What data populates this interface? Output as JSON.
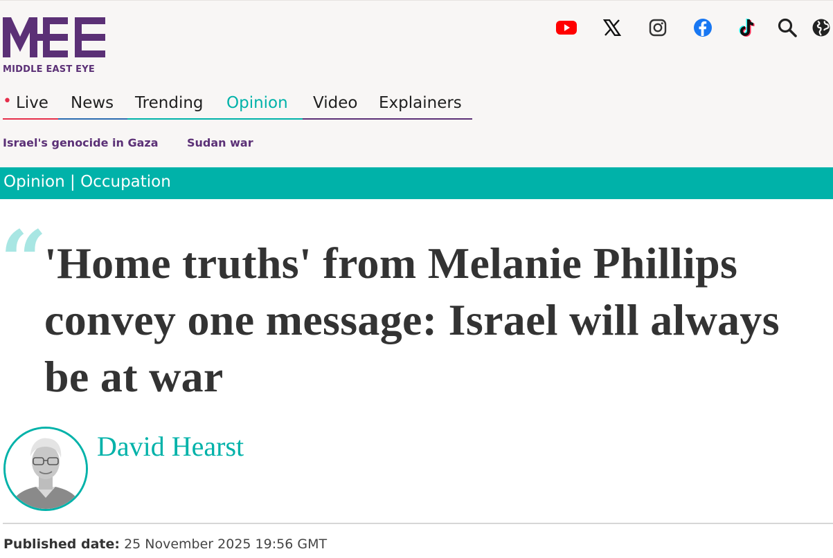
{
  "brand": {
    "logo_text": "MIDDLE EAST EYE",
    "color": "#5b3076",
    "accent": "#00b2a9"
  },
  "social": [
    {
      "name": "youtube-icon",
      "color": "#ff0000"
    },
    {
      "name": "x-icon",
      "color": "#111111"
    },
    {
      "name": "instagram-icon",
      "color": "#333333"
    },
    {
      "name": "facebook-icon",
      "color": "#1877f2"
    },
    {
      "name": "tiktok-icon",
      "color": "#111111"
    },
    {
      "name": "search-icon",
      "color": "#222222"
    },
    {
      "name": "globe-icon",
      "color": "#222222"
    }
  ],
  "nav": {
    "items": [
      {
        "label": "Live",
        "underline": "#e52e4a"
      },
      {
        "label": "News",
        "underline": "#2b6cb0"
      },
      {
        "label": "Trending",
        "underline": "#00b2a9"
      },
      {
        "label": "Opinion",
        "underline": "#00b2a9",
        "active": true
      },
      {
        "label": "Video",
        "underline": "#5b3076"
      },
      {
        "label": "Explainers",
        "underline": "#5b3076"
      }
    ]
  },
  "topics": [
    "Israel's genocide in Gaza",
    "Sudan war"
  ],
  "section": {
    "category": "Opinion",
    "separator": "|",
    "subcategory": "Occupation"
  },
  "article": {
    "quote_mark": "“",
    "headline": "'Home truths' from Melanie Phillips convey one message: Israel will always be at war",
    "author": "David Hearst",
    "published_label": "Published date:",
    "published_value": "25 November 2025 19:56 GMT"
  }
}
